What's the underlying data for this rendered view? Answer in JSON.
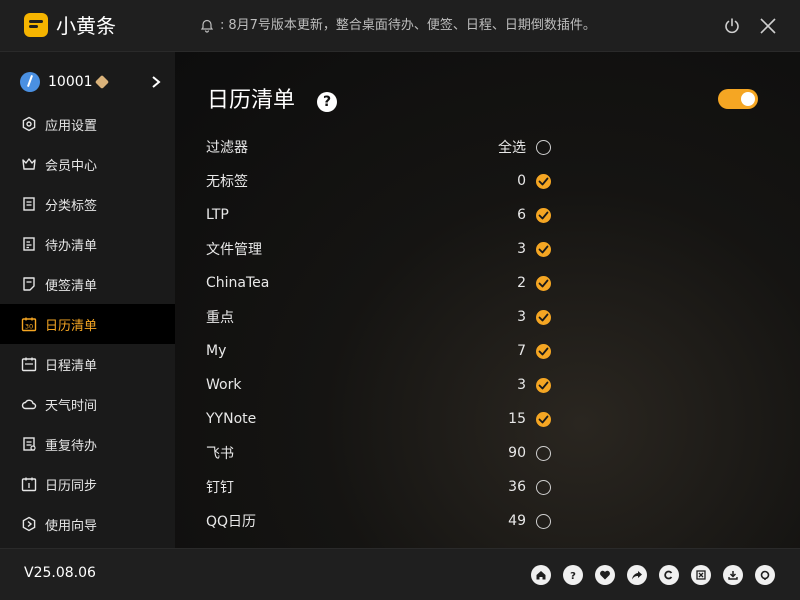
{
  "app": {
    "title": "小黄条"
  },
  "notice": {
    "text": "8月7号版本更新，整合桌面待办、便签、日程、日期倒数插件。"
  },
  "user": {
    "id": "10001"
  },
  "nav": [
    {
      "label": "应用设置",
      "icon": "settings-icon"
    },
    {
      "label": "会员中心",
      "icon": "crown-icon"
    },
    {
      "label": "分类标签",
      "icon": "tag-list-icon"
    },
    {
      "label": "待办清单",
      "icon": "todo-list-icon"
    },
    {
      "label": "便签清单",
      "icon": "note-icon"
    },
    {
      "label": "日历清单",
      "icon": "calendar-30-icon",
      "active": true
    },
    {
      "label": "日程清单",
      "icon": "schedule-icon"
    },
    {
      "label": "天气时间",
      "icon": "cloud-icon"
    },
    {
      "label": "重复待办",
      "icon": "repeat-icon"
    },
    {
      "label": "日历同步",
      "icon": "calendar-sync-icon"
    },
    {
      "label": "使用向导",
      "icon": "guide-icon"
    }
  ],
  "main": {
    "title": "日历清单",
    "help": "?",
    "toggle_on": true,
    "filter_label": "过滤器",
    "select_all_label": "全选",
    "select_all_checked": false,
    "items": [
      {
        "label": "无标签",
        "count": "0",
        "checked": true
      },
      {
        "label": "LTP",
        "count": "6",
        "checked": true
      },
      {
        "label": "文件管理",
        "count": "3",
        "checked": true
      },
      {
        "label": "ChinaTea",
        "count": "2",
        "checked": true
      },
      {
        "label": "重点",
        "count": "3",
        "checked": true
      },
      {
        "label": "My",
        "count": "7",
        "checked": true
      },
      {
        "label": "Work",
        "count": "3",
        "checked": true
      },
      {
        "label": "YYNote",
        "count": "15",
        "checked": true
      },
      {
        "label": "飞书",
        "count": "90",
        "checked": false
      },
      {
        "label": "钉钉",
        "count": "36",
        "checked": false
      },
      {
        "label": "QQ日历",
        "count": "49",
        "checked": false
      }
    ]
  },
  "footer": {
    "version": "V25.08.06",
    "icons": [
      "home-icon",
      "help-icon",
      "heart-icon",
      "share-icon",
      "copyright-icon",
      "excel-export-icon",
      "download-icon",
      "support-icon"
    ]
  },
  "colors": {
    "accent": "#f5a623",
    "logo": "#f5b400",
    "background": "#141414"
  }
}
